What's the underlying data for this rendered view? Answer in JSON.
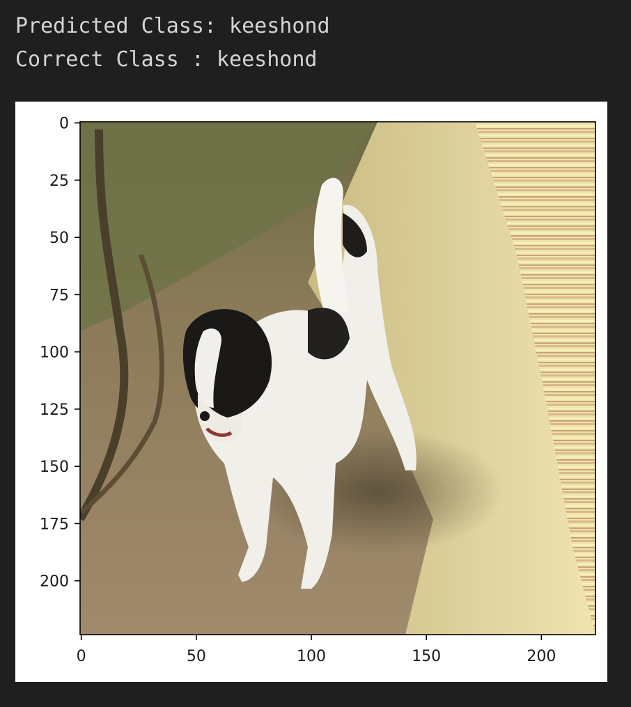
{
  "output": {
    "lines": [
      "Predicted Class: keeshond",
      "Correct Class : keeshond"
    ]
  },
  "chart_data": {
    "type": "image",
    "image_description": "white and black dog standing on dirt and grass, image array shown with imshow",
    "xlim": [
      0,
      224
    ],
    "ylim": [
      224,
      0
    ],
    "x_ticks": [
      0,
      50,
      100,
      150,
      200
    ],
    "y_ticks": [
      0,
      25,
      50,
      75,
      100,
      125,
      150,
      175,
      200
    ],
    "x_tick_labels": [
      "0",
      "50",
      "100",
      "150",
      "200"
    ],
    "y_tick_labels": [
      "0",
      "25",
      "50",
      "75",
      "100",
      "125",
      "150",
      "175",
      "200"
    ]
  }
}
